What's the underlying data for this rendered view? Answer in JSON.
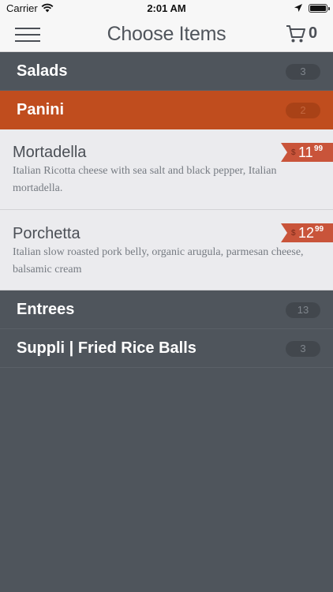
{
  "status_bar": {
    "carrier": "Carrier",
    "time": "2:01 AM"
  },
  "nav": {
    "title": "Choose Items",
    "cart_count": "0"
  },
  "categories": [
    {
      "name": "Salads",
      "count": "3",
      "active": false
    },
    {
      "name": "Panini",
      "count": "2",
      "active": true
    },
    {
      "name": "Entrees",
      "count": "13",
      "active": false
    },
    {
      "name": "Suppli | Fried Rice Balls",
      "count": "3",
      "active": false
    }
  ],
  "items": [
    {
      "name": "Mortadella",
      "description": "Italian Ricotta cheese with sea salt and black pepper, Italian mortadella.",
      "price": {
        "currency": "$",
        "dollars": "11",
        "cents": "99"
      }
    },
    {
      "name": "Porchetta",
      "description": "Italian slow roasted pork belly, organic arugula, parmesan cheese, balsamic cream",
      "price": {
        "currency": "$",
        "dollars": "12",
        "cents": "99"
      }
    }
  ],
  "colors": {
    "accent": "#c04d1e",
    "background": "#4f555c",
    "price_tag": "#c9543a"
  },
  "icons": {
    "menu": "hamburger-menu-icon",
    "cart": "shopping-cart-icon",
    "wifi": "wifi-icon",
    "location": "location-arrow-icon",
    "battery": "battery-icon"
  }
}
